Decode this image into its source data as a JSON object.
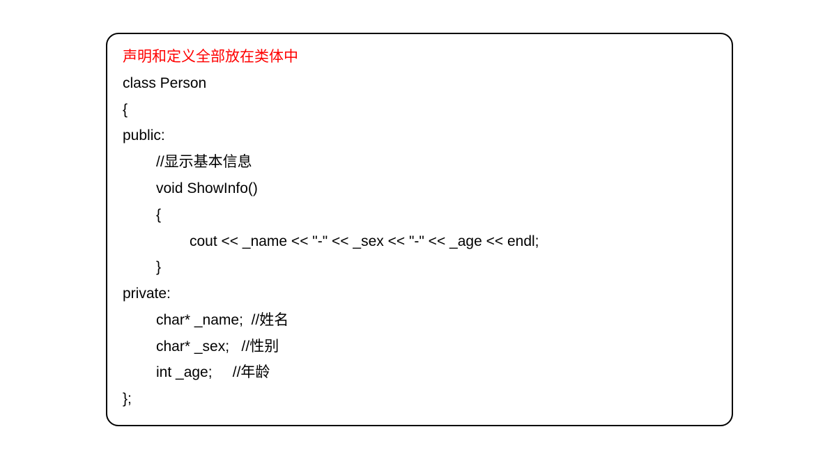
{
  "code": {
    "heading": "声明和定义全部放在类体中",
    "line1": "class Person",
    "line2": "{",
    "line3": "public:",
    "line4": "//显示基本信息",
    "line5": "void ShowInfo()",
    "line6": "{",
    "line7": "cout << _name << \"-\" << _sex << \"-\" << _age << endl;",
    "line8": "}",
    "line9": "private:",
    "line10": "char* _name;  //姓名",
    "line11": "char* _sex;   //性别",
    "line12": "int _age;     //年龄",
    "line13": "};"
  }
}
